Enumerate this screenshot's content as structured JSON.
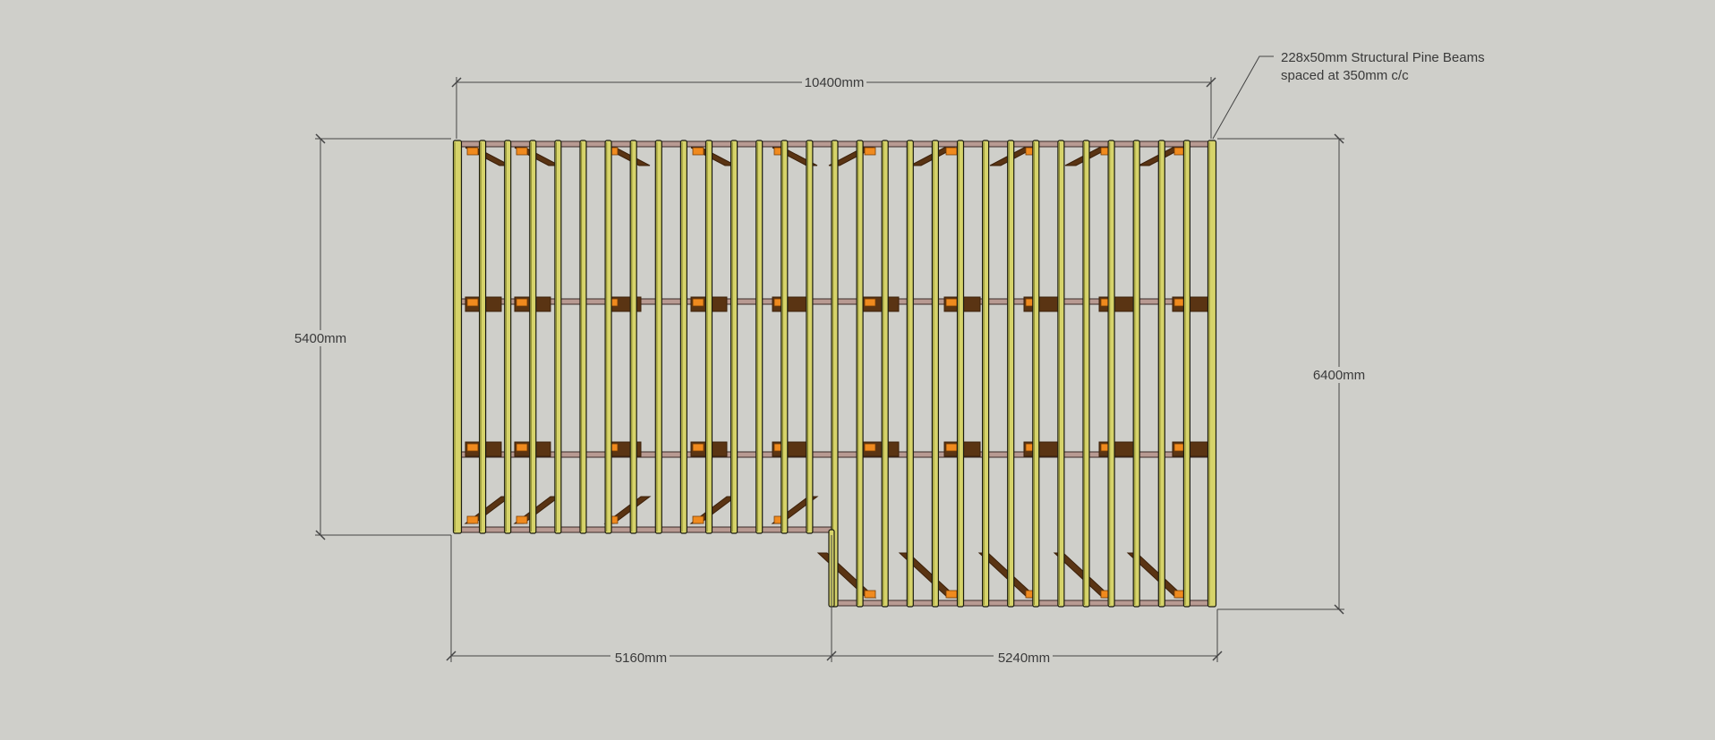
{
  "dimensions": {
    "overall_width": "10400mm",
    "left_width": "5160mm",
    "right_width": "5240mm",
    "left_depth": "5400mm",
    "right_depth": "6400mm"
  },
  "callout": {
    "line1": "228x50mm Structural Pine Beams",
    "line2": "spaced at 350mm c/c"
  },
  "colors": {
    "background": "#cfcfca",
    "beam_fill": "#d6d36a",
    "beam_edge": "#1b1b10",
    "joist": "#5a3413",
    "joist_dark": "#3b200a",
    "block": "#f08a1e",
    "bearer": "#b89a92",
    "dim_line": "#444444"
  }
}
